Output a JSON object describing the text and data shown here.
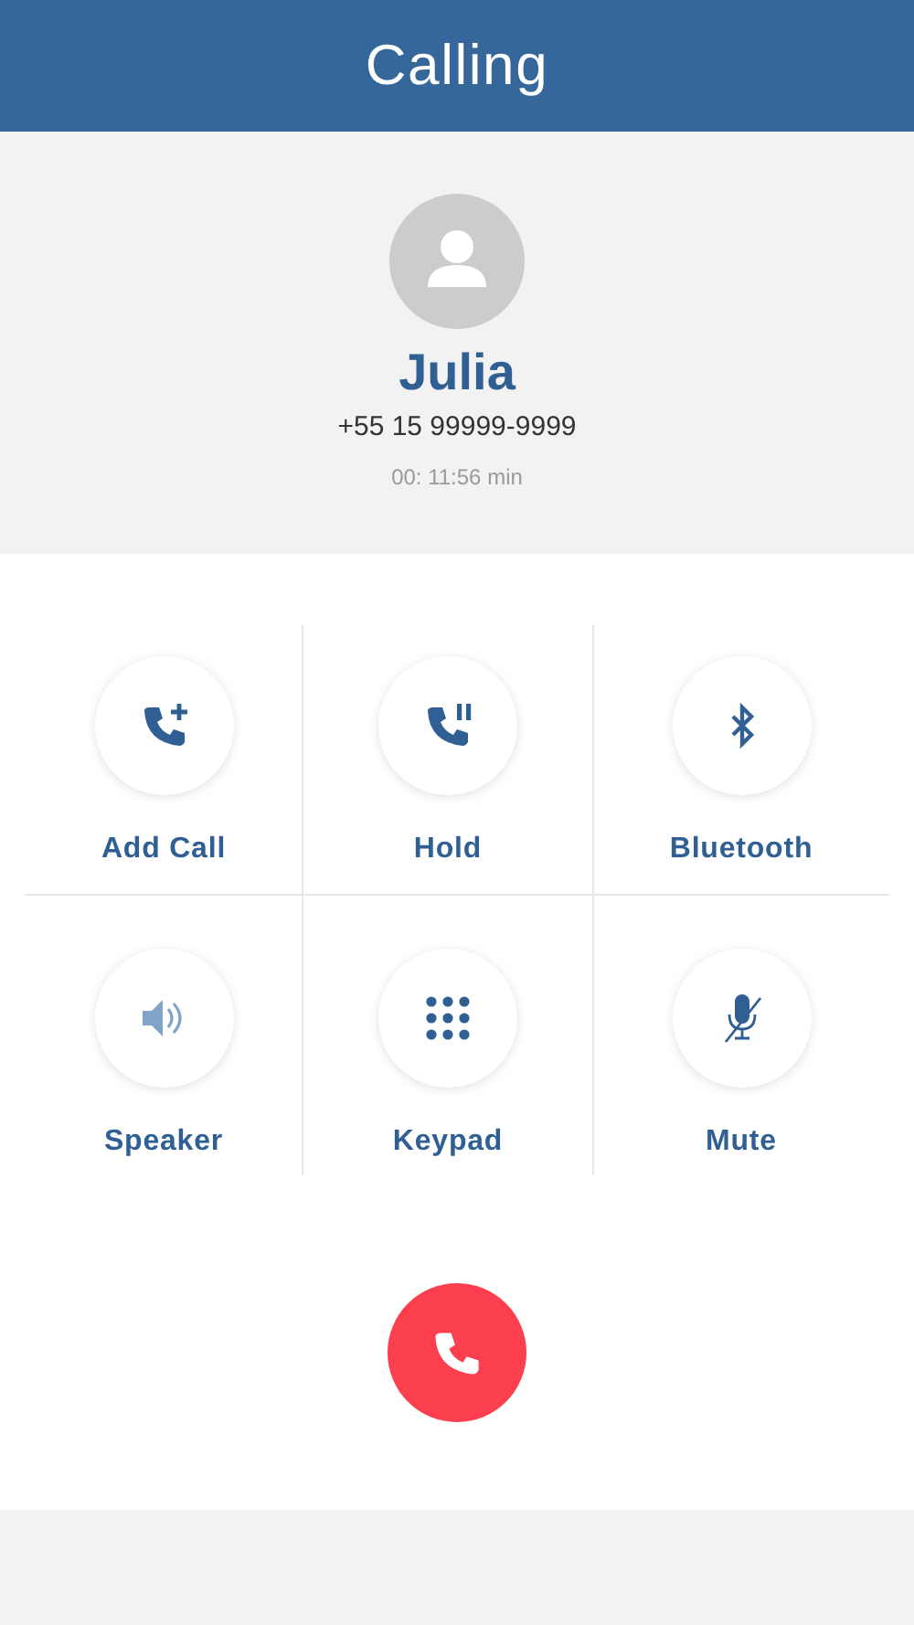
{
  "header": {
    "title": "Calling"
  },
  "contact": {
    "name": "Julia",
    "phone": "+55 15 99999-9999",
    "duration": "00: 11:56 min"
  },
  "actions": [
    {
      "kind": "add-call",
      "label": "Add Call"
    },
    {
      "kind": "hold",
      "label": "Hold"
    },
    {
      "kind": "bluetooth",
      "label": "Bluetooth"
    },
    {
      "kind": "speaker",
      "label": "Speaker"
    },
    {
      "kind": "keypad",
      "label": "Keypad"
    },
    {
      "kind": "mute",
      "label": "Mute"
    }
  ],
  "end_call": {
    "kind": "hang-up"
  }
}
